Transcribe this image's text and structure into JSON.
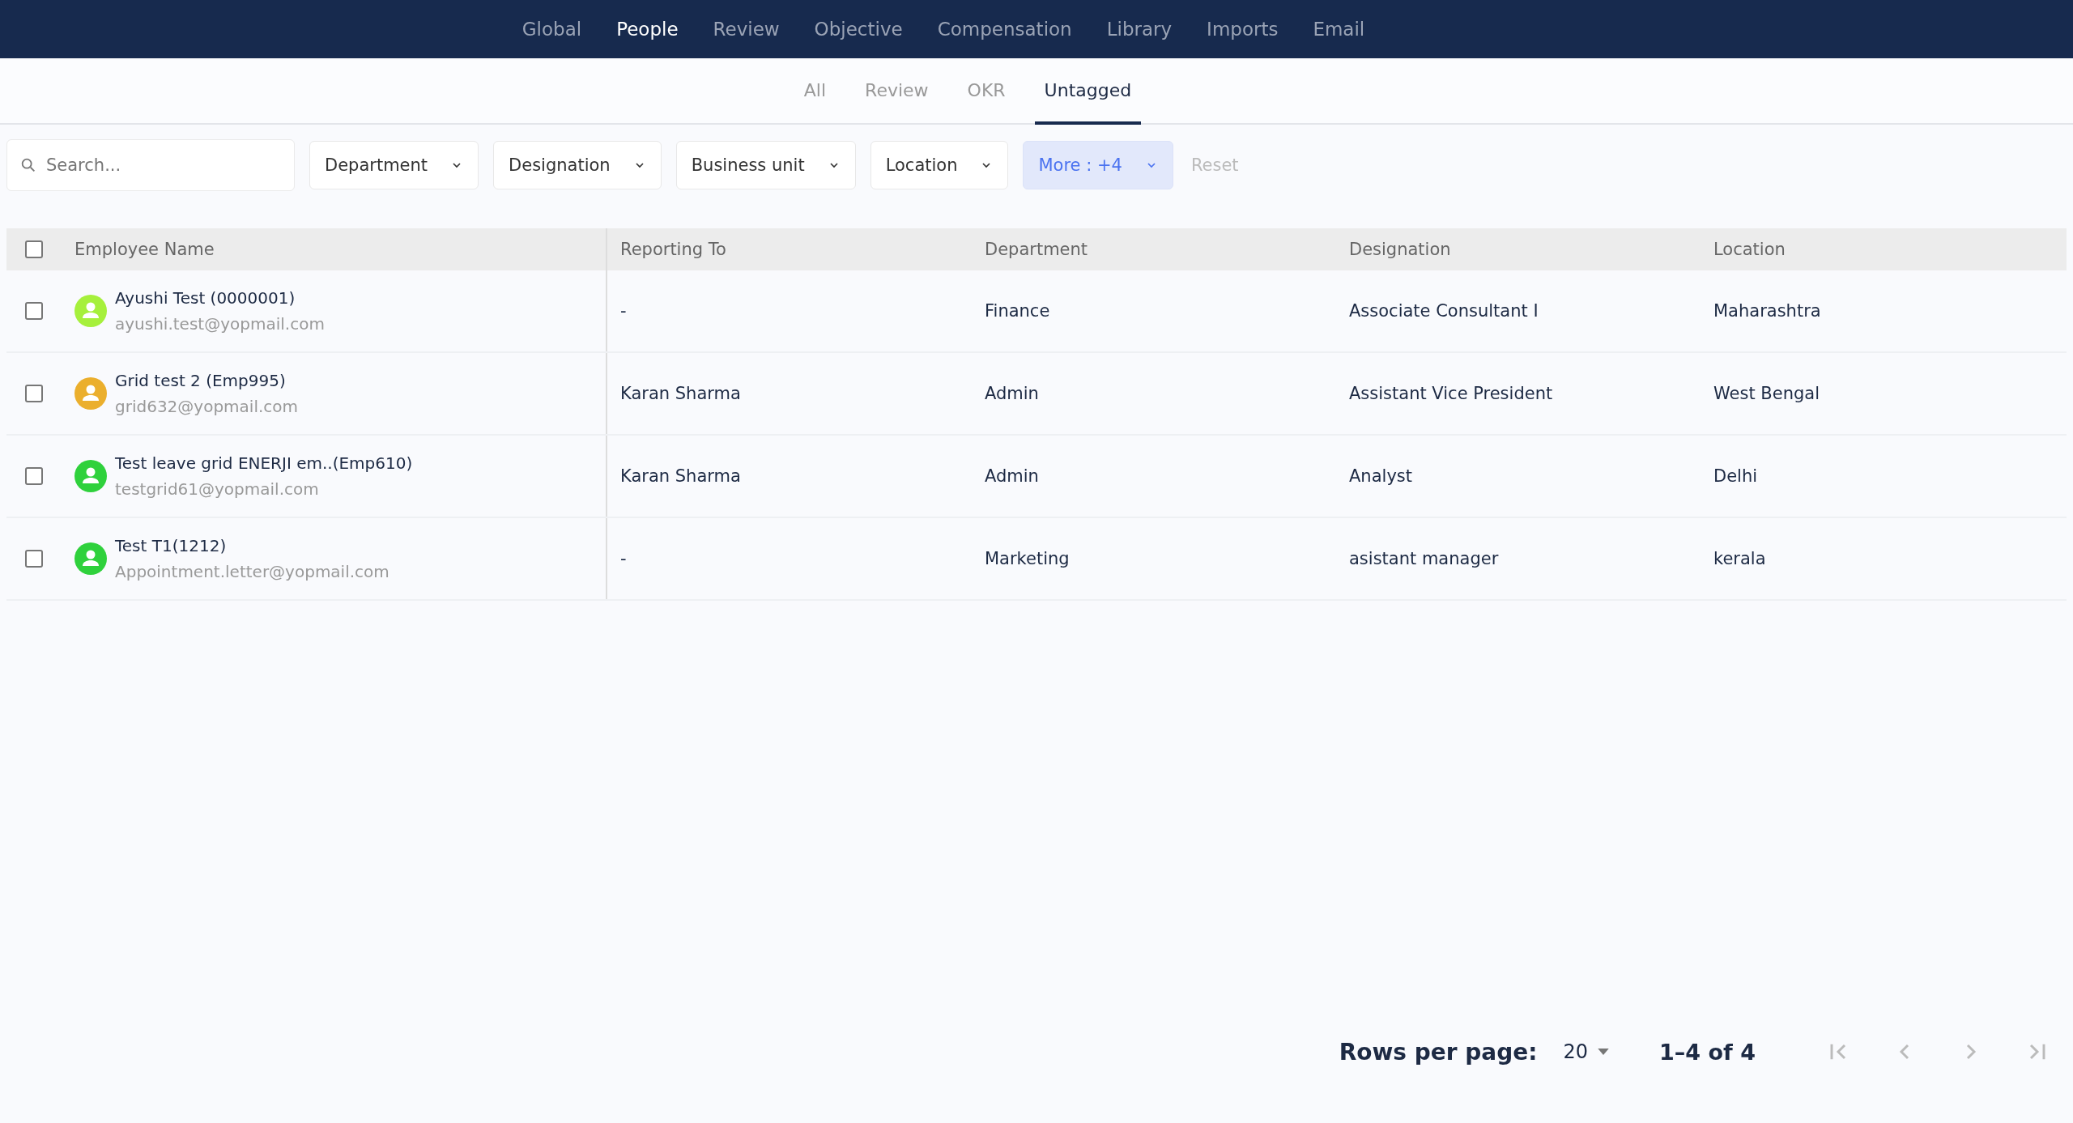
{
  "nav": [
    {
      "label": "Global",
      "selected": false
    },
    {
      "label": "People",
      "selected": true
    },
    {
      "label": "Review",
      "selected": false
    },
    {
      "label": "Objective",
      "selected": false
    },
    {
      "label": "Compensation",
      "selected": false
    },
    {
      "label": "Library",
      "selected": false
    },
    {
      "label": "Imports",
      "selected": false
    },
    {
      "label": "Email",
      "selected": false
    }
  ],
  "subtabs": [
    {
      "label": "All",
      "selected": false
    },
    {
      "label": "Review",
      "selected": false
    },
    {
      "label": "OKR",
      "selected": false
    },
    {
      "label": "Untagged",
      "selected": true
    }
  ],
  "search": {
    "placeholder": "Search..."
  },
  "filters": [
    {
      "label": "Department",
      "active": false
    },
    {
      "label": "Designation",
      "active": false
    },
    {
      "label": "Business unit",
      "active": false
    },
    {
      "label": "Location",
      "active": false
    },
    {
      "label": "More : +4",
      "active": true
    }
  ],
  "reset": "Reset",
  "table": {
    "select_all": false,
    "columns": [
      "Employee Name",
      "Reporting To",
      "Department",
      "Designation",
      "Location"
    ],
    "rows": [
      {
        "checked": false,
        "color": "#a6f03c",
        "name": "Ayushi Test (0000001)",
        "email": "ayushi.test@yopmail.com",
        "reporting_to": "-",
        "department": "Finance",
        "designation": "Associate Consultant I",
        "location": "Maharashtra"
      },
      {
        "checked": false,
        "color": "#ebaf2d",
        "name": "Grid test 2 (Emp995)",
        "email": "grid632@yopmail.com",
        "reporting_to": "Karan Sharma",
        "department": "Admin",
        "designation": "Assistant Vice President",
        "location": "West Bengal"
      },
      {
        "checked": false,
        "color": "#2fd13c",
        "name": "Test leave grid ENERJI em..(Emp610)",
        "email": "testgrid61@yopmail.com",
        "reporting_to": "Karan Sharma",
        "department": "Admin",
        "designation": "Analyst",
        "location": "Delhi"
      },
      {
        "checked": false,
        "color": "#2fd13c",
        "name": "Test T1(1212)",
        "email": "Appointment.letter@yopmail.com",
        "reporting_to": "-",
        "department": "Marketing",
        "designation": "asistant manager",
        "location": "kerala"
      }
    ]
  },
  "pagination": {
    "rows_label": "Rows per page:",
    "rows_value": "20",
    "range": "1–4 of 4",
    "buttons": [
      {
        "kind": "first",
        "disabled": true
      },
      {
        "kind": "prev",
        "disabled": true
      },
      {
        "kind": "next",
        "disabled": true
      },
      {
        "kind": "last",
        "disabled": true
      }
    ]
  }
}
